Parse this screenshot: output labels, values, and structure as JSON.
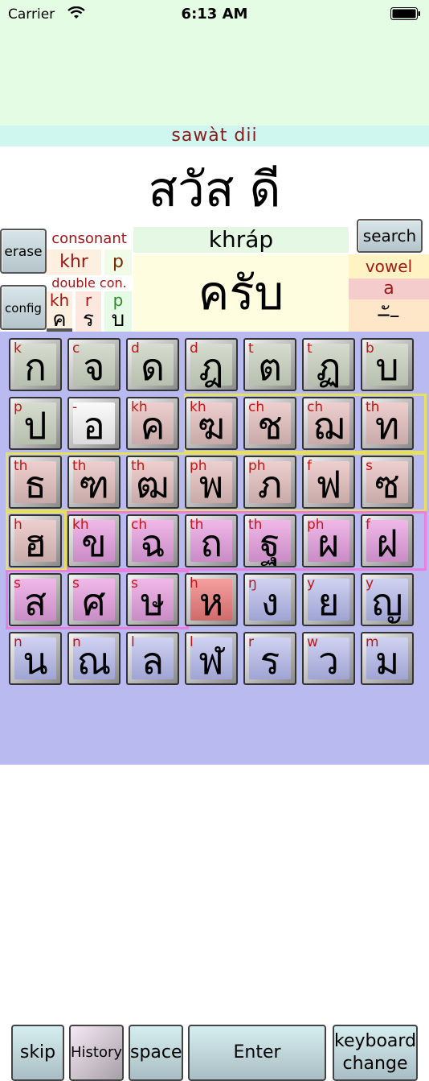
{
  "status_bar": {
    "carrier": "Carrier",
    "time": "6:13 AM"
  },
  "roman_line": "sawàt  dii",
  "thai_line": "สวัส ดี",
  "buttons": {
    "erase": "erase",
    "config": "config",
    "search": "search"
  },
  "consonant_panel": {
    "label": "consonant",
    "roman": "khr",
    "roman2": "p",
    "double_label": "double con.",
    "cells": [
      {
        "roman": "kh",
        "thai": "ค"
      },
      {
        "roman": "r",
        "thai": "ร"
      },
      {
        "roman": "p",
        "thai": "บ"
      }
    ]
  },
  "current_word": {
    "roman": "khráp",
    "thai": "ครับ"
  },
  "vowel_panel": {
    "label": "vowel",
    "roman": "a",
    "glyph": "–ั–"
  },
  "keyboard": {
    "rows": [
      [
        {
          "r": "k",
          "t": "ก"
        },
        {
          "r": "c",
          "t": "จ"
        },
        {
          "r": "d",
          "t": "ด"
        },
        {
          "r": "d",
          "t": "ฎ"
        },
        {
          "r": "t",
          "t": "ต"
        },
        {
          "r": "t",
          "t": "ฏ"
        },
        {
          "r": "b",
          "t": "บ"
        }
      ],
      [
        {
          "r": "p",
          "t": "ป"
        },
        {
          "r": "-",
          "t": "อ"
        },
        {
          "r": "kh",
          "t": "ค"
        },
        {
          "r": "kh",
          "t": "ฆ"
        },
        {
          "r": "ch",
          "t": "ช"
        },
        {
          "r": "ch",
          "t": "ฌ"
        },
        {
          "r": "th",
          "t": "ท"
        }
      ],
      [
        {
          "r": "th",
          "t": "ธ"
        },
        {
          "r": "th",
          "t": "ฑ"
        },
        {
          "r": "th",
          "t": "ฒ"
        },
        {
          "r": "ph",
          "t": "พ"
        },
        {
          "r": "ph",
          "t": "ภ"
        },
        {
          "r": "f",
          "t": "ฟ"
        },
        {
          "r": "s",
          "t": "ซ"
        }
      ],
      [
        {
          "r": "h",
          "t": "ฮ"
        },
        {
          "r": "kh",
          "t": "ข"
        },
        {
          "r": "ch",
          "t": "ฉ"
        },
        {
          "r": "th",
          "t": "ถ"
        },
        {
          "r": "th",
          "t": "ฐ"
        },
        {
          "r": "ph",
          "t": "ผ"
        },
        {
          "r": "f",
          "t": "ฝ"
        }
      ],
      [
        {
          "r": "s",
          "t": "ส"
        },
        {
          "r": "s",
          "t": "ศ"
        },
        {
          "r": "s",
          "t": "ษ"
        },
        {
          "r": "h",
          "t": "ห"
        },
        {
          "r": "ŋ",
          "t": "ง"
        },
        {
          "r": "y",
          "t": "ย"
        },
        {
          "r": "y",
          "t": "ญ"
        }
      ],
      [
        {
          "r": "n",
          "t": "น"
        },
        {
          "r": "n",
          "t": "ณ"
        },
        {
          "r": "l",
          "t": "ล"
        },
        {
          "r": "l",
          "t": "ฬ"
        },
        {
          "r": "r",
          "t": "ร"
        },
        {
          "r": "w",
          "t": "ว"
        },
        {
          "r": "m",
          "t": "ม"
        }
      ]
    ],
    "bottom": {
      "skip": "skip",
      "history": "History",
      "space": "space",
      "enter": "Enter",
      "keyboard_change": "keyboard\nchange"
    }
  },
  "colors": {
    "mid_class": "#f0c8c8",
    "high_class": "#e8a8e0",
    "low_class": "#c8cbe8",
    "accent_red": "#a01818"
  }
}
